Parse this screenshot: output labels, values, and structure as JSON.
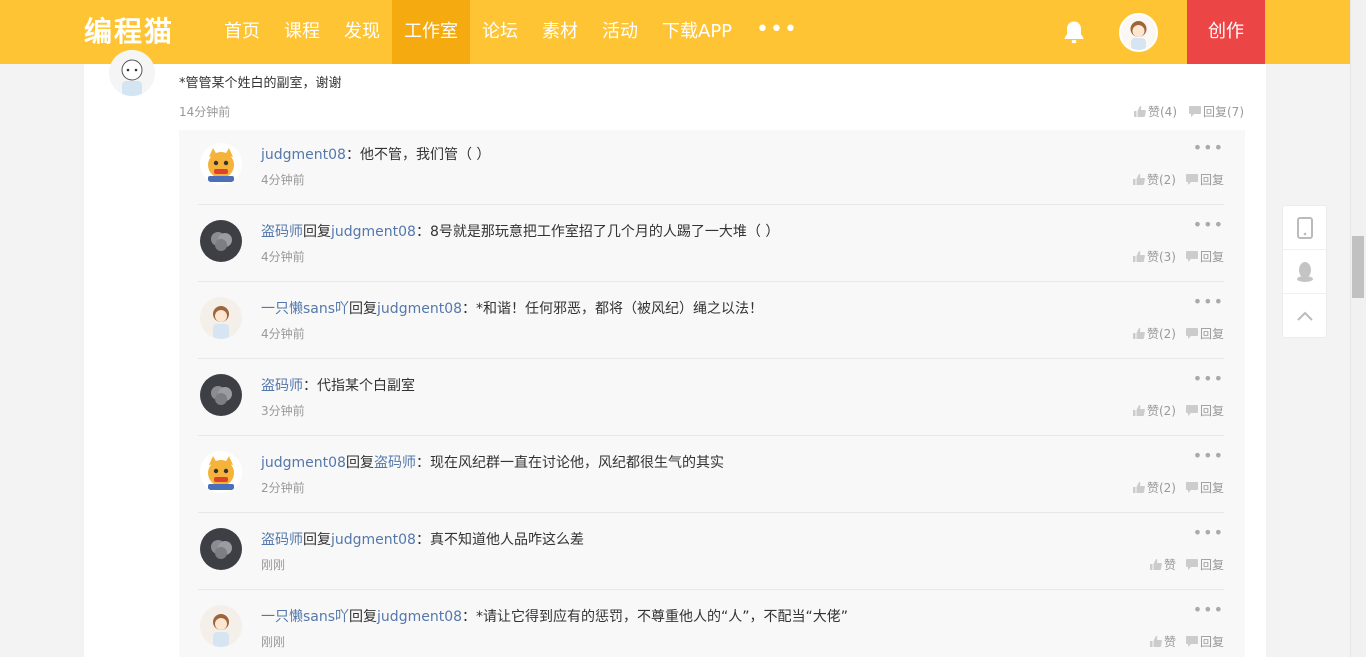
{
  "nav": {
    "logo": "编程猫",
    "items": [
      "首页",
      "课程",
      "发现",
      "工作室",
      "论坛",
      "素材",
      "活动",
      "下载APP"
    ],
    "more": "•••",
    "create": "创作"
  },
  "main_comment": {
    "text": "*管管某个姓白的副室，谢谢",
    "time": "14分钟前",
    "like_label": "赞(4)",
    "reply_label": "回复(7)"
  },
  "replies": [
    {
      "user": "judgment08",
      "connector": "",
      "target": "",
      "text": "：他不管，我们管（ ）",
      "time": "4分钟前",
      "like": "赞(2)",
      "reply": "回复",
      "avatar": "cat"
    },
    {
      "user": "盗码师",
      "connector": "回复",
      "target": "judgment08",
      "text": "：8号就是那玩意把工作室招了几个月的人踢了一大堆（ ）",
      "time": "4分钟前",
      "like": "赞(3)",
      "reply": "回复",
      "avatar": "dark"
    },
    {
      "user": "一只懒sans吖",
      "connector": "回复",
      "target": "judgment08",
      "text": "：*和谐！任何邪恶，都将（被风纪）绳之以法！",
      "time": "4分钟前",
      "like": "赞(2)",
      "reply": "回复",
      "avatar": "light"
    },
    {
      "user": "盗码师",
      "connector": "",
      "target": "",
      "text": "：代指某个白副室",
      "time": "3分钟前",
      "like": "赞(2)",
      "reply": "回复",
      "avatar": "dark"
    },
    {
      "user": "judgment08",
      "connector": "回复",
      "target": "盗码师",
      "text": "：现在风纪群一直在讨论他，风纪都很生气的其实",
      "time": "2分钟前",
      "like": "赞(2)",
      "reply": "回复",
      "avatar": "cat"
    },
    {
      "user": "盗码师",
      "connector": "回复",
      "target": "judgment08",
      "text": "：真不知道他人品咋这么差",
      "time": "刚刚",
      "like": "赞",
      "reply": "回复",
      "avatar": "dark"
    },
    {
      "user": "一只懒sans吖",
      "connector": "回复",
      "target": "judgment08",
      "text": "：*请让它得到应有的惩罚，不尊重他人的“人”，不配当“大佬”",
      "time": "刚刚",
      "like": "赞",
      "reply": "回复",
      "avatar": "light"
    }
  ],
  "reply_dots": "•••",
  "colors": {
    "nav_bg": "#fec433",
    "nav_active": "#f5aa0f",
    "create_bg": "#ec4545",
    "link": "#5478aa"
  }
}
